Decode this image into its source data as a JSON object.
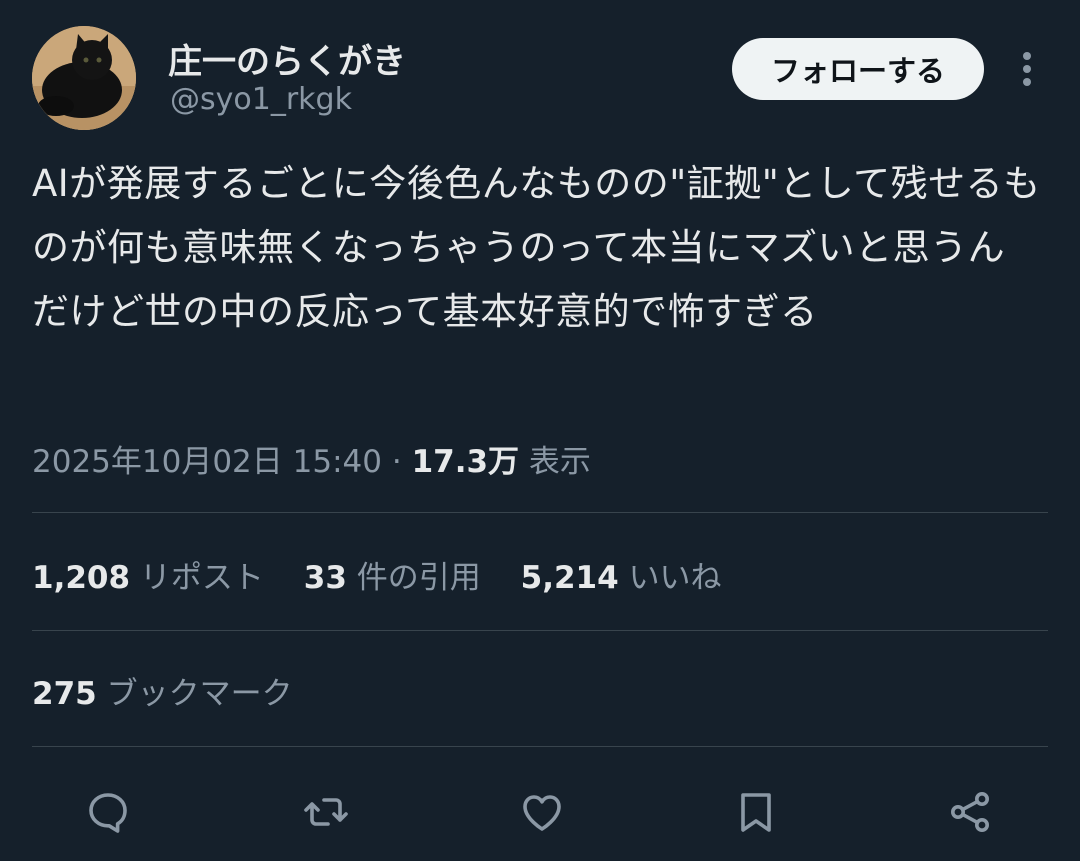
{
  "author": {
    "display_name": "庄一のらくがき",
    "handle": "@syo1_rkgk"
  },
  "header": {
    "follow_label": "フォローする"
  },
  "tweet": {
    "text": "AIが発展するごとに今後色んなものの\"証拠\"として残せるものが何も意味無くなっちゃうのって本当にマズいと思うんだけど世の中の反応って基本好意的で怖すぎる",
    "timestamp": "2025年10月02日 15:40",
    "separator": "·",
    "views_count": "17.3万",
    "views_label": "表示"
  },
  "stats": {
    "reposts_count": "1,208",
    "reposts_label": "リポスト",
    "quotes_count": "33",
    "quotes_label": "件の引用",
    "likes_count": "5,214",
    "likes_label": "いいね",
    "bookmarks_count": "275",
    "bookmarks_label": "ブックマーク"
  },
  "actions": [
    "reply-icon",
    "repost-icon",
    "like-icon",
    "bookmark-icon",
    "share-icon"
  ],
  "colors": {
    "background": "#15202b",
    "text": "#e7e9ea",
    "muted": "#8b98a5",
    "divider": "#38444d",
    "follow_bg": "#eff3f4"
  }
}
